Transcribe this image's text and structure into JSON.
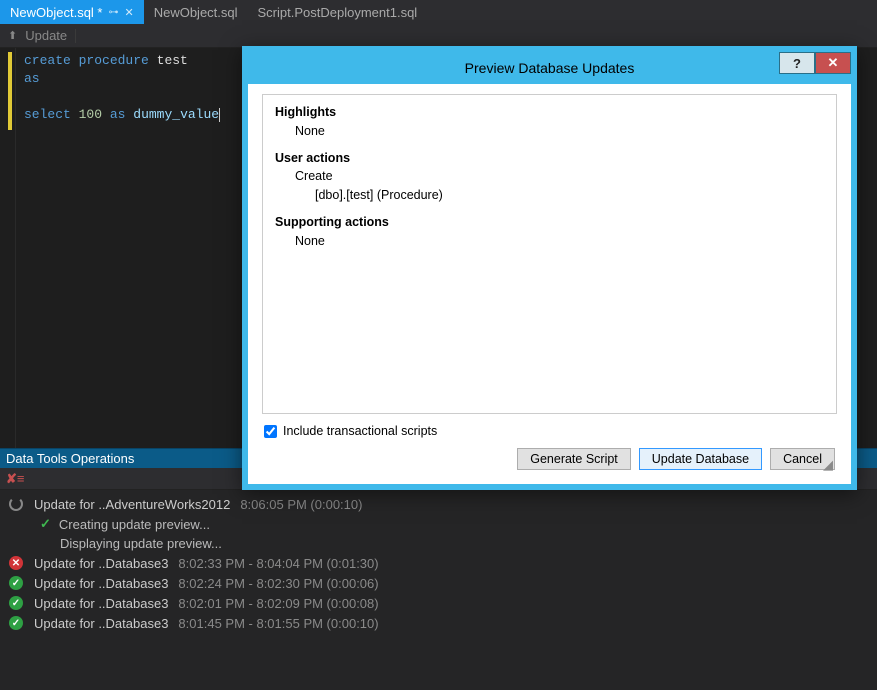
{
  "tabs": [
    {
      "label": "NewObject.sql *",
      "active": true,
      "pinned": true,
      "closeable": true
    },
    {
      "label": "NewObject.sql",
      "active": false,
      "pinned": false,
      "closeable": false
    },
    {
      "label": "Script.PostDeployment1.sql",
      "active": false,
      "pinned": false,
      "closeable": false
    }
  ],
  "toolbar": {
    "update_label": "Update"
  },
  "code": {
    "line1_kw1": "create",
    "line1_kw2": "procedure",
    "line1_ident": "test",
    "line2_kw": "as",
    "line4_kw1": "select",
    "line4_num": "100",
    "line4_kw2": "as",
    "line4_ident": "dummy_value"
  },
  "panel": {
    "title": "Data Tools Operations"
  },
  "operations": [
    {
      "status": "spin",
      "label": "Update for ..AdventureWorks2012",
      "time": "8:06:05 PM (0:00:10)",
      "subs": [
        {
          "icon": "check",
          "text": "Creating update preview..."
        },
        {
          "icon": "none",
          "text": "Displaying update preview..."
        }
      ]
    },
    {
      "status": "err",
      "label": "Update for ..Database3",
      "time": "8:02:33 PM - 8:04:04 PM (0:01:30)"
    },
    {
      "status": "ok",
      "label": "Update for ..Database3",
      "time": "8:02:24 PM - 8:02:30 PM (0:00:06)"
    },
    {
      "status": "ok",
      "label": "Update for ..Database3",
      "time": "8:02:01 PM - 8:02:09 PM (0:00:08)"
    },
    {
      "status": "ok",
      "label": "Update for ..Database3",
      "time": "8:01:45 PM - 8:01:55 PM (0:00:10)"
    }
  ],
  "dialog": {
    "title": "Preview Database Updates",
    "help": "?",
    "close": "✕",
    "highlights_hdr": "Highlights",
    "highlights_body": "None",
    "user_actions_hdr": "User actions",
    "user_actions_l1": "Create",
    "user_actions_l2": "[dbo].[test] (Procedure)",
    "supporting_hdr": "Supporting actions",
    "supporting_body": "None",
    "checkbox_label": "Include transactional scripts",
    "checkbox_checked": true,
    "btn_generate": "Generate Script",
    "btn_update": "Update Database",
    "btn_cancel": "Cancel"
  }
}
